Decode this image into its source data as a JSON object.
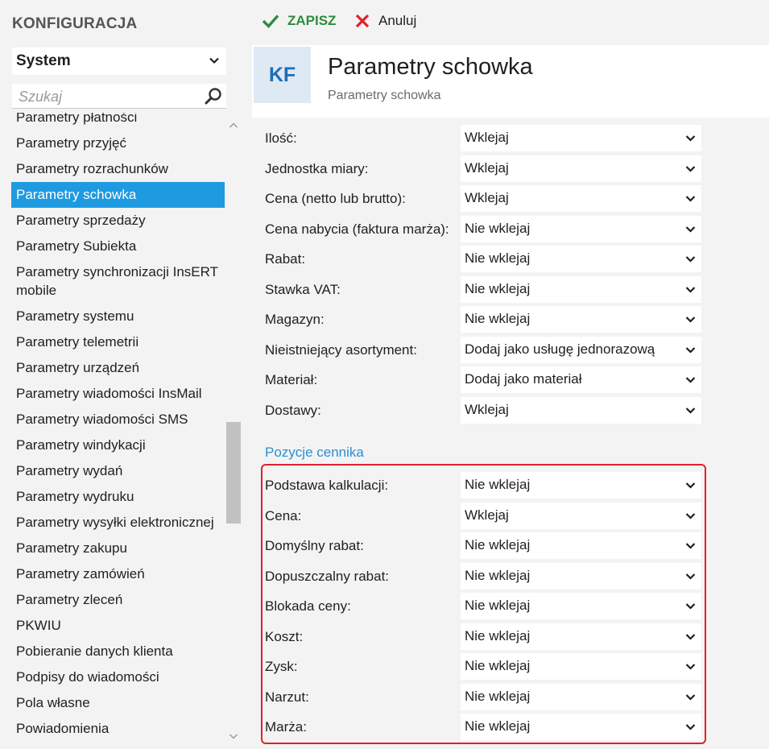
{
  "sidebar": {
    "title": "KONFIGURACJA",
    "selector": {
      "value": "System"
    },
    "search": {
      "placeholder": "Szukaj"
    },
    "items": [
      {
        "label": "Parametry płatności",
        "active": false
      },
      {
        "label": "Parametry przyjęć",
        "active": false
      },
      {
        "label": "Parametry rozrachunków",
        "active": false
      },
      {
        "label": "Parametry schowka",
        "active": true
      },
      {
        "label": "Parametry sprzedaży",
        "active": false
      },
      {
        "label": "Parametry Subiekta",
        "active": false
      },
      {
        "label": "Parametry synchronizacji InsERT mobile",
        "active": false
      },
      {
        "label": "Parametry systemu",
        "active": false
      },
      {
        "label": "Parametry telemetrii",
        "active": false
      },
      {
        "label": "Parametry urządzeń",
        "active": false
      },
      {
        "label": "Parametry wiadomości InsMail",
        "active": false
      },
      {
        "label": "Parametry wiadomości SMS",
        "active": false
      },
      {
        "label": "Parametry windykacji",
        "active": false
      },
      {
        "label": "Parametry wydań",
        "active": false
      },
      {
        "label": "Parametry wydruku",
        "active": false
      },
      {
        "label": "Parametry wysyłki elektronicznej",
        "active": false
      },
      {
        "label": "Parametry zakupu",
        "active": false
      },
      {
        "label": "Parametry zamówień",
        "active": false
      },
      {
        "label": "Parametry zleceń",
        "active": false
      },
      {
        "label": "PKWIU",
        "active": false
      },
      {
        "label": "Pobieranie danych klienta",
        "active": false
      },
      {
        "label": "Podpisy do wiadomości",
        "active": false
      },
      {
        "label": "Pola własne",
        "active": false
      },
      {
        "label": "Powiadomienia",
        "active": false
      }
    ]
  },
  "toolbar": {
    "save_label": "ZAPISZ",
    "cancel_label": "Anuluj"
  },
  "header": {
    "badge": "KF",
    "title": "Parametry schowka",
    "subtitle": "Parametry schowka"
  },
  "fields": [
    {
      "label": "Ilość:",
      "value": "Wklejaj"
    },
    {
      "label": "Jednostka miary:",
      "value": "Wklejaj"
    },
    {
      "label": "Cena (netto lub brutto):",
      "value": "Wklejaj"
    },
    {
      "label": "Cena nabycia (faktura marża):",
      "value": "Nie wklejaj"
    },
    {
      "label": "Rabat:",
      "value": "Nie wklejaj"
    },
    {
      "label": "Stawka VAT:",
      "value": "Nie wklejaj"
    },
    {
      "label": "Magazyn:",
      "value": "Nie wklejaj"
    },
    {
      "label": "Nieistniejący asortyment:",
      "value": "Dodaj jako usługę jednorazową"
    },
    {
      "label": "Materiał:",
      "value": "Dodaj jako materiał"
    },
    {
      "label": "Dostawy:",
      "value": "Wklejaj"
    }
  ],
  "pricelist": {
    "title": "Pozycje cennika",
    "fields": [
      {
        "label": "Podstawa kalkulacji:",
        "value": "Nie wklejaj"
      },
      {
        "label": "Cena:",
        "value": "Wklejaj"
      },
      {
        "label": "Domyślny rabat:",
        "value": "Nie wklejaj"
      },
      {
        "label": "Dopuszczalny rabat:",
        "value": "Nie wklejaj"
      },
      {
        "label": "Blokada ceny:",
        "value": "Nie wklejaj"
      },
      {
        "label": "Koszt:",
        "value": "Nie wklejaj"
      },
      {
        "label": "Zysk:",
        "value": "Nie wklejaj"
      },
      {
        "label": "Narzut:",
        "value": "Nie wklejaj"
      },
      {
        "label": "Marża:",
        "value": "Nie wklejaj"
      }
    ]
  },
  "colors": {
    "accent": "#1e9ae0",
    "save": "#2e8b3e",
    "cancel": "#e2202a",
    "section": "#2a8fd0",
    "highlight": "#e2202a"
  }
}
